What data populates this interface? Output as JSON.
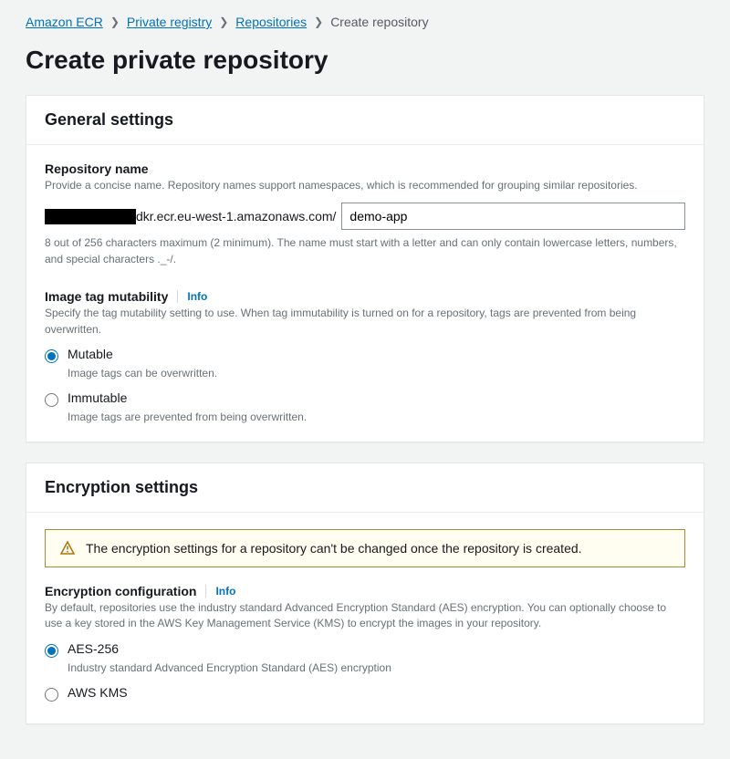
{
  "breadcrumb": {
    "items": [
      "Amazon ECR",
      "Private registry",
      "Repositories"
    ],
    "current": "Create repository"
  },
  "pageTitle": "Create private repository",
  "general": {
    "heading": "General settings",
    "repoName": {
      "label": "Repository name",
      "description": "Provide a concise name. Repository names support namespaces, which is recommended for grouping similar repositories.",
      "prefix": "dkr.ecr.eu-west-1.amazonaws.com/",
      "value": "demo-app",
      "hint": "8 out of 256 characters maximum (2 minimum). The name must start with a letter and can only contain lowercase letters, numbers, and special characters ._-/."
    },
    "mutability": {
      "label": "Image tag mutability",
      "infoLabel": "Info",
      "description": "Specify the tag mutability setting to use. When tag immutability is turned on for a repository, tags are prevented from being overwritten.",
      "options": [
        {
          "label": "Mutable",
          "sub": "Image tags can be overwritten."
        },
        {
          "label": "Immutable",
          "sub": "Image tags are prevented from being overwritten."
        }
      ]
    }
  },
  "encryption": {
    "heading": "Encryption settings",
    "alert": "The encryption settings for a repository can't be changed once the repository is created.",
    "config": {
      "label": "Encryption configuration",
      "infoLabel": "Info",
      "description": "By default, repositories use the industry standard Advanced Encryption Standard (AES) encryption. You can optionally choose to use a key stored in the AWS Key Management Service (KMS) to encrypt the images in your repository.",
      "options": [
        {
          "label": "AES-256",
          "sub": "Industry standard Advanced Encryption Standard (AES) encryption"
        },
        {
          "label": "AWS KMS"
        }
      ]
    }
  }
}
